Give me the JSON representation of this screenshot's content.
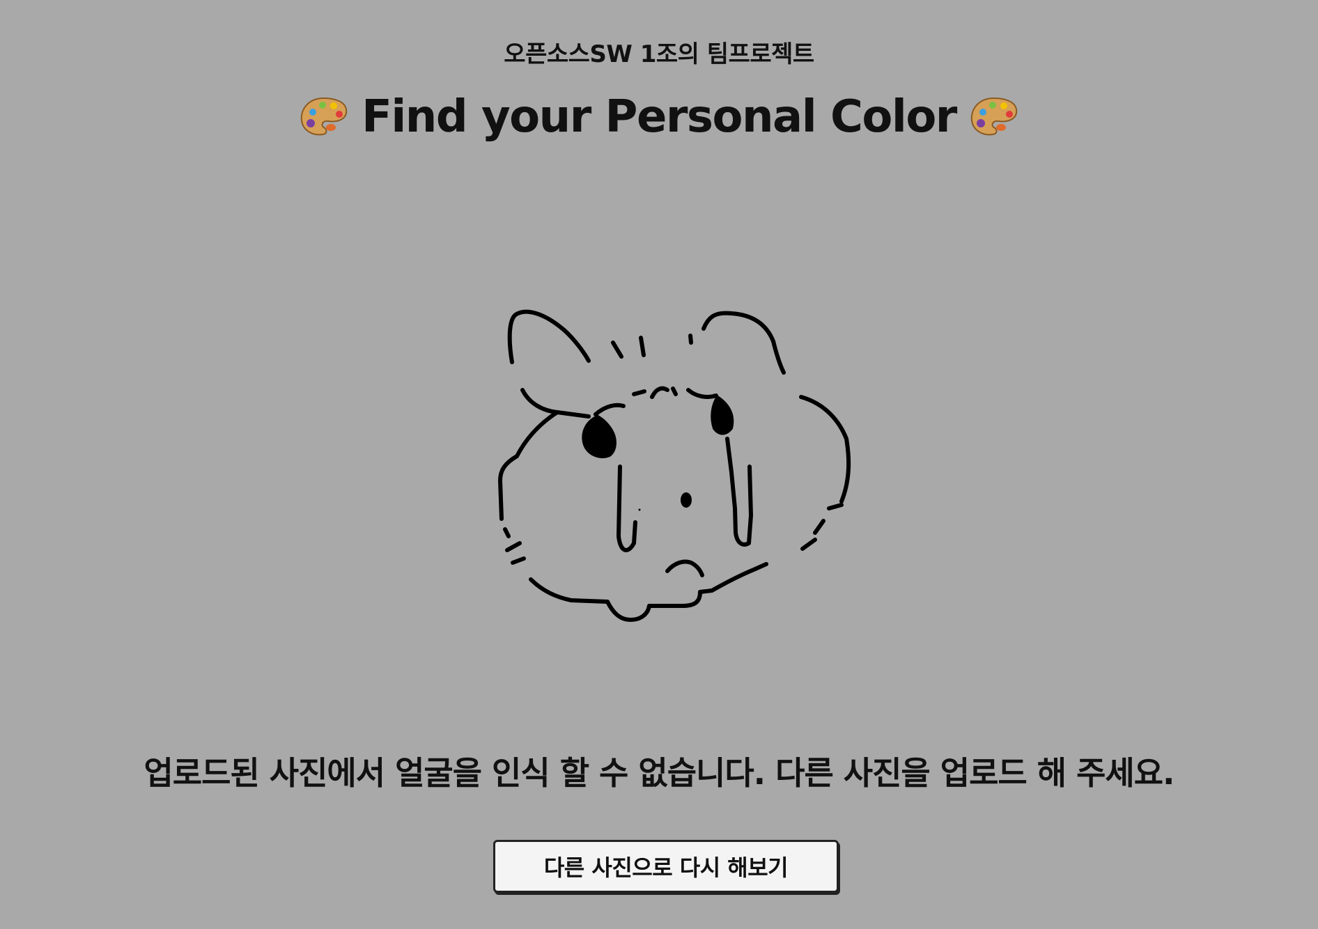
{
  "header": {
    "subtitle": "오픈소스SW 1조의 팀프로젝트",
    "title": "Find your Personal Color",
    "title_icon": "artist-palette-icon"
  },
  "main": {
    "uploaded_image": "crying-hamster-drawing",
    "message": "업로드된 사진에서 얼굴을 인식 할 수 없습니다. 다른 사진을 업로드 해 주세요.",
    "retry_button_label": "다른 사진으로 다시 해보기"
  },
  "colors": {
    "background": "#a9a9a9",
    "text": "#111111",
    "button_bg": "#f4f4f4"
  }
}
